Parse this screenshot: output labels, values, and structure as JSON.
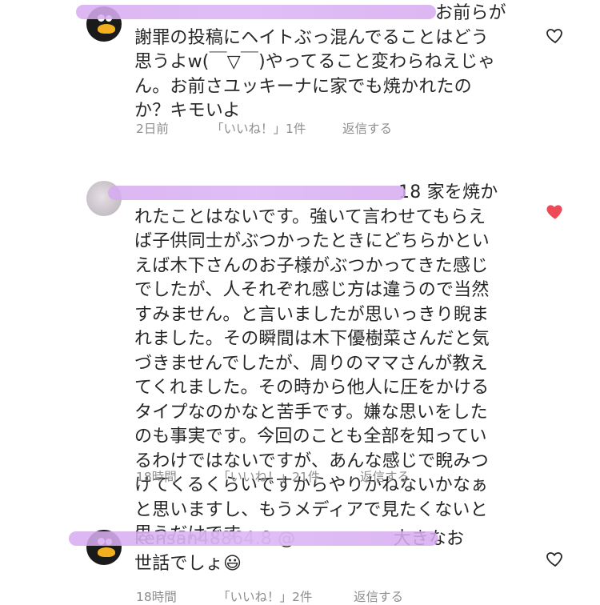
{
  "comments": [
    {
      "text": "お前らが\n謝罪の投稿にヘイトぶっ混んでることはどう\n思うよw(￣▽￣)やってること変わらねえじゃ\nん。お前さユッキーナに家でも焼かれたの\nか？キモいよ",
      "time": "2日前",
      "likes": "「いいね！」1件",
      "reply": "返信する",
      "liked": false
    },
    {
      "text": "18 家を焼か\nれたことはないです。強いて言わせてもらえ\nば子供同士がぶつかったときにどちらかとい\nえば木下さんのお子様がぶつかってきた感じ\nでしたが、人それぞれ感じ方は違うので当然\nすみません。と言いましたが思いっきり睨ま\nれました。その瞬間は木下優樹菜さんだと気\nづきませんでしたが、周りのママさんが教え\nてくれました。その時から他人に圧をかける\nタイプなのかなと苦手です。嫌な思いをした\nのも事実です。今回のことも全部を知ってい\nるわけではないですが、あんな感じで睨みつ\nけてくるくらいですからやりかねないかなぁ\nと思いますし、もうメディアで見たくないと\n思うだけです",
      "time": "18時間",
      "likes": "「いいね！」21件",
      "reply": "返信する",
      "liked": true
    },
    {
      "text": "kensan48864.8 @                 大きなお\n世話でしょ😃",
      "time": "18時間",
      "likes": "「いいね！」2件",
      "reply": "返信する",
      "liked": false
    }
  ],
  "colors": {
    "like_red": "#ed4956",
    "meta_gray": "#8e8e8e",
    "redaction": "#d9aef0"
  },
  "icons": {
    "heart_outline": "heart-outline-icon",
    "heart_filled": "heart-filled-icon"
  }
}
